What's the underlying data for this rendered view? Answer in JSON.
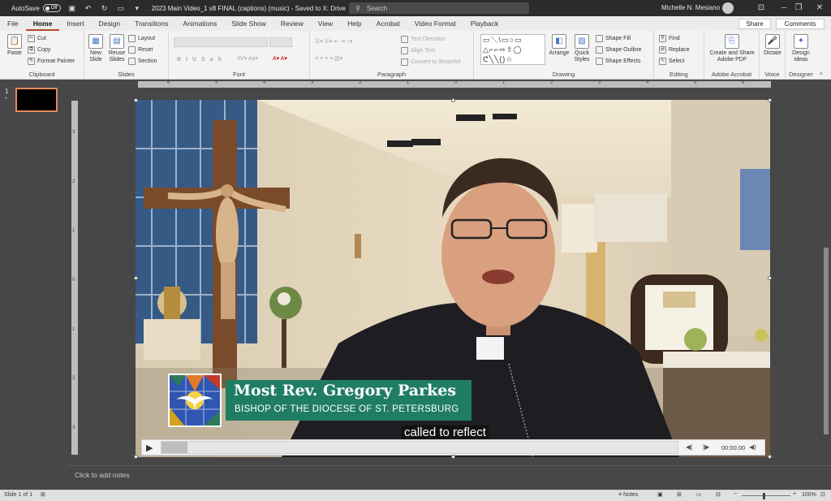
{
  "titlebar": {
    "autosave": "AutoSave",
    "autosave_state": "Off",
    "doc_title": "2023 Main Video_1 v8 FINAL (captions) (music)  -  Saved to X: Drive",
    "search_placeholder": "Search",
    "user": "Michelle N. Mesiano"
  },
  "menu": {
    "tabs": [
      "File",
      "Home",
      "Insert",
      "Design",
      "Transitions",
      "Animations",
      "Slide Show",
      "Review",
      "View",
      "Help",
      "Acrobat",
      "Video Format",
      "Playback"
    ],
    "active": "Home",
    "share": "Share",
    "comments": "Comments"
  },
  "ribbon": {
    "clipboard": {
      "label": "Clipboard",
      "paste": "Paste",
      "cut": "Cut",
      "copy": "Copy",
      "format_painter": "Format Painter"
    },
    "slides": {
      "label": "Slides",
      "new_slide": "New Slide",
      "reuse": "Reuse Slides",
      "layout": "Layout",
      "reset": "Reset",
      "section": "Section"
    },
    "font": {
      "label": "Font"
    },
    "paragraph": {
      "label": "Paragraph",
      "text_direction": "Text Direction",
      "align_text": "Align Text",
      "smartart": "Convert to SmartArt"
    },
    "drawing": {
      "label": "Drawing",
      "arrange": "Arrange",
      "quick_styles": "Quick Styles",
      "fill": "Shape Fill",
      "outline": "Shape Outline",
      "effects": "Shape Effects"
    },
    "editing": {
      "label": "Editing",
      "find": "Find",
      "replace": "Replace",
      "select": "Select"
    },
    "acrobat": {
      "label": "Adobe Acrobat",
      "create": "Create and Share Adobe PDF"
    },
    "voice": {
      "label": "Voice",
      "dictate": "Dictate"
    },
    "designer": {
      "label": "Designer",
      "ideas": "Design Ideas"
    }
  },
  "slides_panel": {
    "number": "1",
    "star": "*"
  },
  "slide": {
    "lower_third_name": "Most Rev. Gregory Parkes",
    "lower_third_title": "BISHOP OF THE DIOCESE OF ST. PETERSBURG",
    "caption": "called to reflect",
    "video_time": "00:00.00",
    "progress_fraction": 0.05
  },
  "ruler": {
    "h_ticks": [
      "6",
      "5",
      "4",
      "3",
      "2",
      "1",
      "0",
      "1",
      "2",
      "3",
      "4",
      "5",
      "6"
    ],
    "v_ticks": [
      "3",
      "2",
      "1",
      "0",
      "1",
      "2",
      "3"
    ]
  },
  "notes": {
    "placeholder": "Click to add notes"
  },
  "status": {
    "slide": "Slide 1 of 1",
    "notes": "Notes",
    "zoom": "100%"
  }
}
